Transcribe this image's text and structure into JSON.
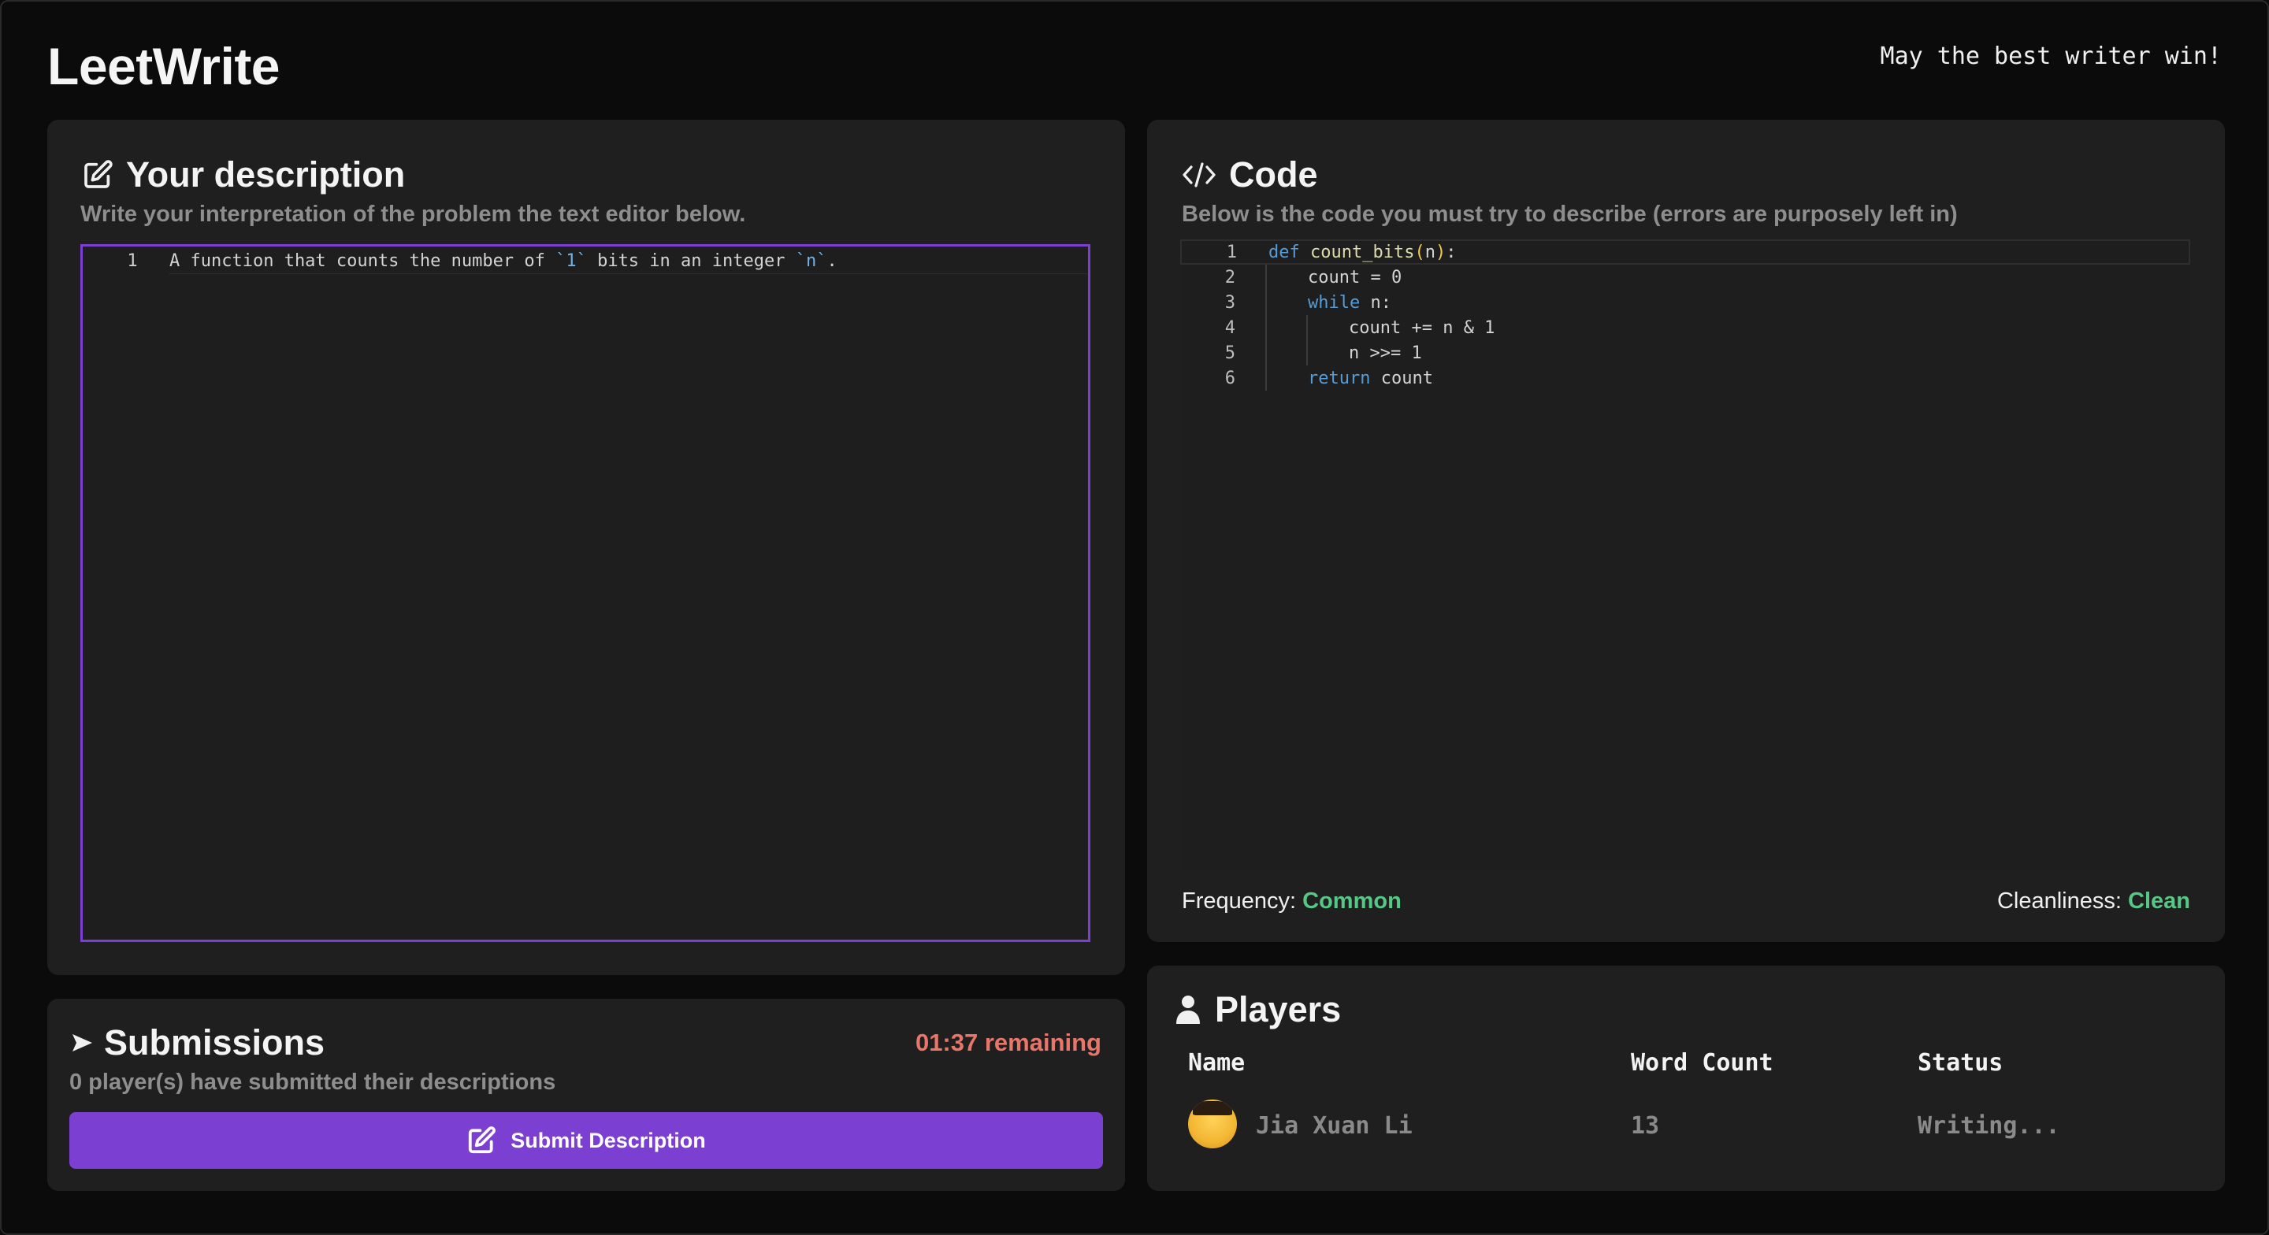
{
  "app": {
    "title": "LeetWrite",
    "tagline": "May the best writer win!"
  },
  "description": {
    "title": "Your description",
    "subtitle": "Write your interpretation of the problem the text editor below.",
    "editor": {
      "line_number": "1",
      "text_parts": [
        "A function that counts the number of ",
        "`1`",
        " bits in an integer ",
        "`n`",
        "."
      ]
    }
  },
  "code": {
    "title": "Code",
    "subtitle": "Below is the code you must try to describe (errors are purposely left in)",
    "lines": [
      {
        "no": "1",
        "text": "def count_bits(n):"
      },
      {
        "no": "2",
        "text": "count = 0"
      },
      {
        "no": "3",
        "text": "while n:"
      },
      {
        "no": "4",
        "text": "count += n & 1"
      },
      {
        "no": "5",
        "text": "n >>= 1"
      },
      {
        "no": "6",
        "text": "return count"
      }
    ],
    "frequency_label": "Frequency:",
    "frequency_value": "Common",
    "cleanliness_label": "Cleanliness:",
    "cleanliness_value": "Clean"
  },
  "submissions": {
    "title": "Submissions",
    "subtitle": "0 player(s) have submitted their descriptions",
    "timer": "01:37 remaining",
    "submit_label": "Submit Description"
  },
  "players": {
    "title": "Players",
    "columns": [
      "Name",
      "Word Count",
      "Status"
    ],
    "rows": [
      {
        "name": "Jia Xuan Li",
        "word_count": "13",
        "status": "Writing..."
      }
    ]
  },
  "colors": {
    "accent": "#7b3fd1",
    "timer": "#e8766a",
    "good": "#57c785"
  },
  "icons": [
    "edit-icon",
    "code-icon",
    "send-icon",
    "user-icon"
  ]
}
